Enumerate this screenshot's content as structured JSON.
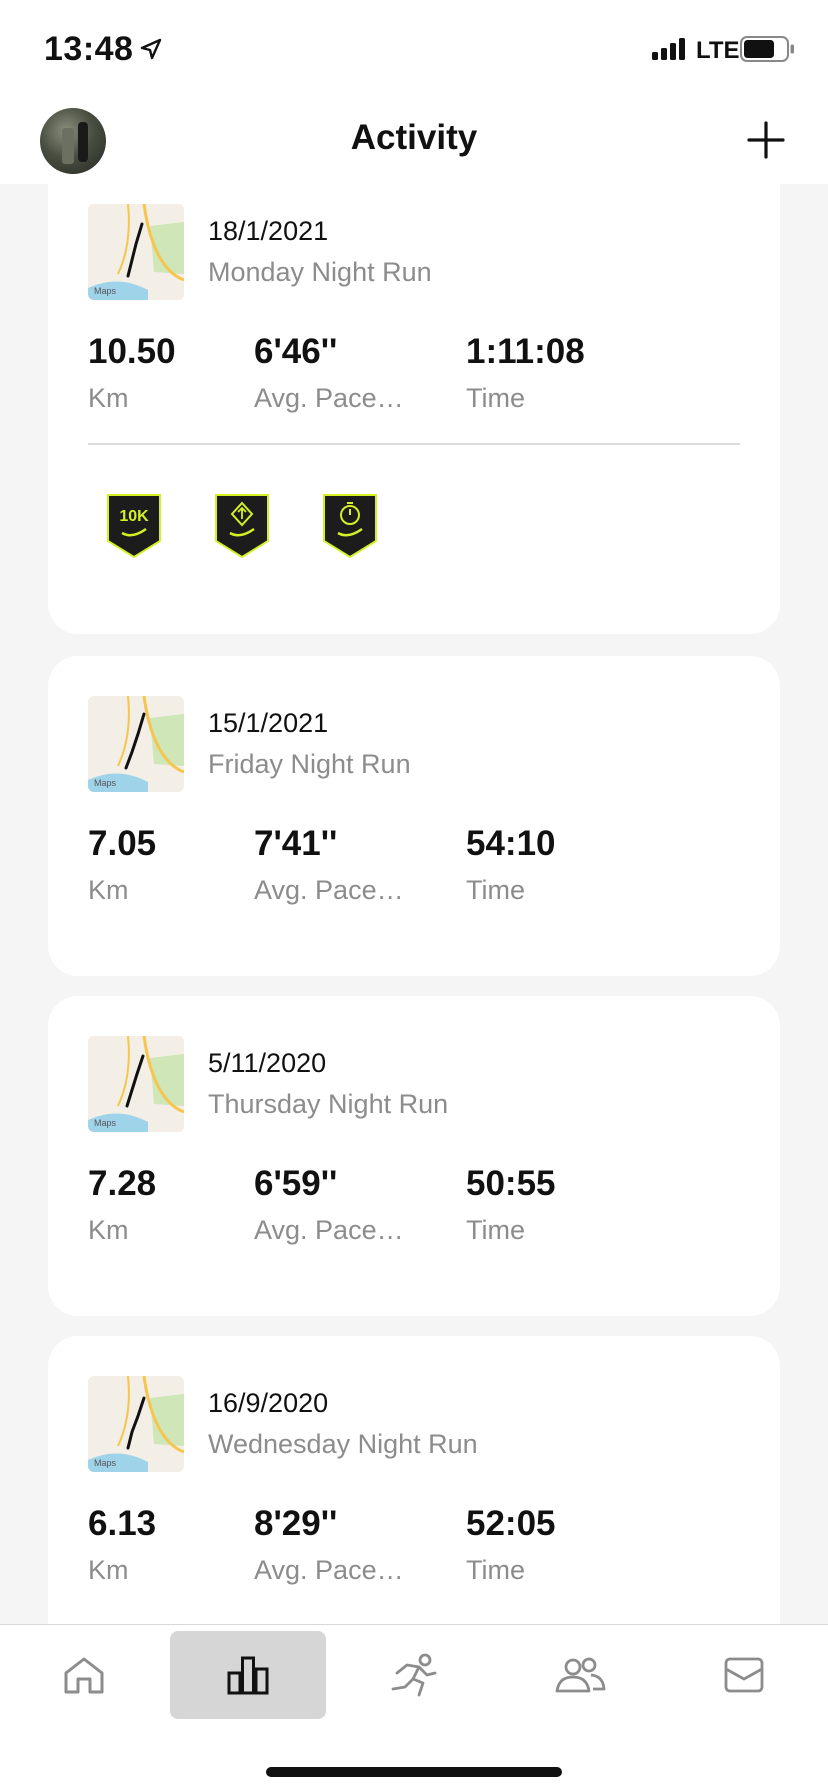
{
  "status_bar": {
    "time": "13:48",
    "network": "LTE",
    "icons": [
      "location-arrow-icon",
      "signal-bars-icon",
      "battery-icon"
    ]
  },
  "header": {
    "title": "Activity",
    "left": "avatar",
    "right_icon": "plus-icon"
  },
  "activities": [
    {
      "date": "18/1/2021",
      "name": "Monday Night Run",
      "map_label": "Maps",
      "stats": [
        {
          "value": "10.50",
          "label": "Km"
        },
        {
          "value": "6'46''",
          "label": "Avg. Pace…"
        },
        {
          "value": "1:11:08",
          "label": "Time"
        }
      ],
      "badges": [
        {
          "icon": "10k-badge-icon",
          "text": "10K"
        },
        {
          "icon": "direction-badge-icon",
          "text": ""
        },
        {
          "icon": "stopwatch-badge-icon",
          "text": ""
        }
      ]
    },
    {
      "date": "15/1/2021",
      "name": "Friday Night Run",
      "map_label": "Maps",
      "stats": [
        {
          "value": "7.05",
          "label": "Km"
        },
        {
          "value": "7'41''",
          "label": "Avg. Pace…"
        },
        {
          "value": "54:10",
          "label": "Time"
        }
      ]
    },
    {
      "date": "5/11/2020",
      "name": "Thursday Night Run",
      "map_label": "Maps",
      "stats": [
        {
          "value": "7.28",
          "label": "Km"
        },
        {
          "value": "6'59''",
          "label": "Avg. Pace…"
        },
        {
          "value": "50:55",
          "label": "Time"
        }
      ]
    },
    {
      "date": "16/9/2020",
      "name": "Wednesday Night Run",
      "map_label": "Maps",
      "stats": [
        {
          "value": "6.13",
          "label": "Km"
        },
        {
          "value": "8'29''",
          "label": "Avg. Pace…"
        },
        {
          "value": "52:05",
          "label": "Time"
        }
      ]
    }
  ],
  "tab_bar": {
    "tabs": [
      {
        "icon": "home-icon",
        "active": false
      },
      {
        "icon": "activity-chart-icon",
        "active": true
      },
      {
        "icon": "runner-icon",
        "active": false
      },
      {
        "icon": "club-people-icon",
        "active": false
      },
      {
        "icon": "inbox-icon",
        "active": false
      }
    ]
  },
  "colors": {
    "background": "#f5f5f5",
    "card": "#ffffff",
    "primary_text": "#111111",
    "secondary_text": "#8c8c8c",
    "badge_bg": "#1c1c1c",
    "badge_accent": "#d4f025",
    "active_tab": "#d6d6d6"
  }
}
